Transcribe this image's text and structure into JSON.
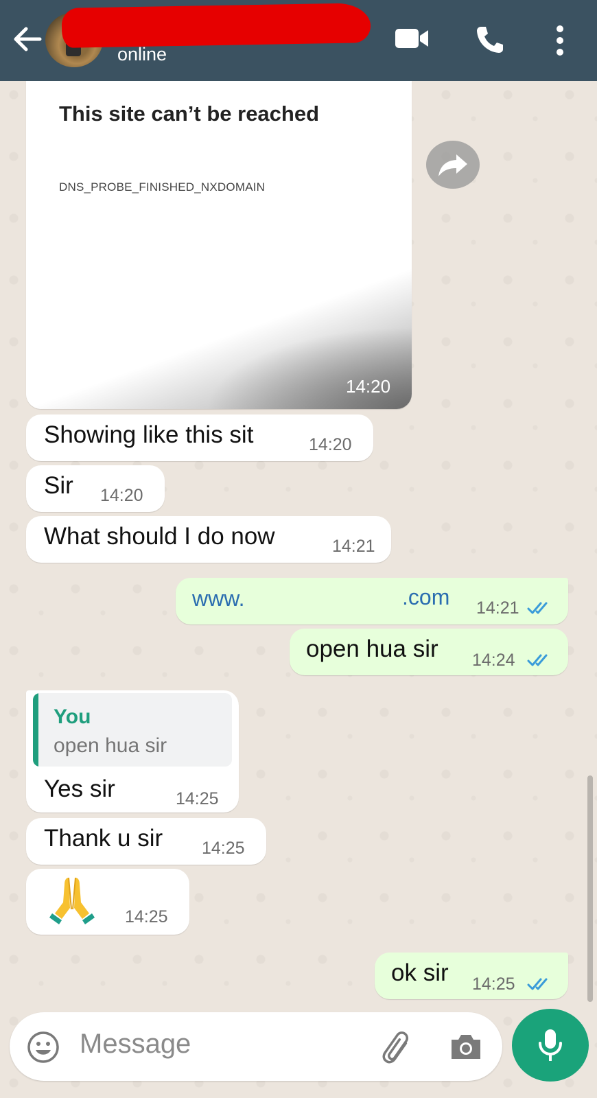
{
  "header": {
    "status": "online"
  },
  "colors": {
    "header_bg": "#3b5261",
    "chat_bg": "#ece5dd",
    "incoming_bubble": "#ffffff",
    "outgoing_bubble": "#e7ffdb",
    "accent": "#1aa37a",
    "read_ticks": "#34b7f1",
    "redaction": "#e60000"
  },
  "link_preview": {
    "title": "This site can’t be reached",
    "code": "DNS_PROBE_FINISHED_NXDOMAIN",
    "time": "14:20"
  },
  "messages": [
    {
      "text": "Showing like this sit",
      "time": "14:20",
      "direction": "in"
    },
    {
      "text": "Sir",
      "time": "14:20",
      "direction": "in"
    },
    {
      "text": "What should I do now",
      "time": "14:21",
      "direction": "in"
    },
    {
      "text_start": "www.",
      "text_end": ".com",
      "time": "14:21",
      "direction": "out",
      "status": "read"
    },
    {
      "text": "open hua sir",
      "time": "14:24",
      "direction": "out",
      "status": "read"
    },
    {
      "quote_author": "You",
      "quote_text": "open hua sir",
      "text": "Yes sir",
      "time": "14:25",
      "direction": "in"
    },
    {
      "text": "Thank u sir",
      "time": "14:25",
      "direction": "in"
    },
    {
      "emoji": "folded-hands",
      "time": "14:25",
      "direction": "in"
    },
    {
      "text": "ok sir",
      "time": "14:25",
      "direction": "out",
      "status": "read"
    }
  ],
  "input": {
    "placeholder": "Message"
  },
  "icons": {
    "back": "arrow-left-icon",
    "video": "video-call-icon",
    "call": "phone-icon",
    "menu": "more-vertical-icon",
    "share": "forward-icon",
    "emoji": "emoji-icon",
    "attach": "paperclip-icon",
    "camera": "camera-icon",
    "mic": "microphone-icon"
  }
}
